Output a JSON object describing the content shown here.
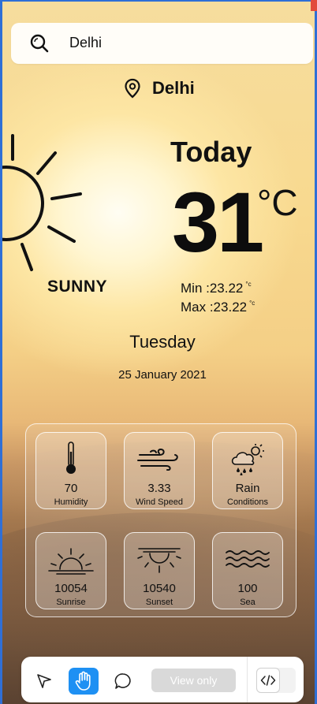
{
  "search": {
    "value": "Delhi",
    "icon": "search-icon"
  },
  "location": {
    "city": "Delhi",
    "icon": "location-pin-icon"
  },
  "weather": {
    "condition": "SUNNY",
    "heading": "Today",
    "temperature": "31",
    "unit": "°C",
    "min_label": "Min :23.22",
    "max_label": "Max :23.22",
    "min_unit": "°c",
    "max_unit": "°c",
    "day": "Tuesday",
    "date": "25 January 2021"
  },
  "stats": [
    {
      "value": "70",
      "label": "Humidity",
      "icon": "thermometer-icon"
    },
    {
      "value": "3.33",
      "label": "Wind Speed",
      "icon": "wind-icon"
    },
    {
      "value": "Rain",
      "label": "Conditions",
      "icon": "rain-cloud-icon"
    },
    {
      "value": "10054",
      "label": "Sunrise",
      "icon": "sunrise-icon"
    },
    {
      "value": "10540",
      "label": "Sunset",
      "icon": "sunset-icon"
    },
    {
      "value": "100",
      "label": "Sea",
      "icon": "waves-icon"
    }
  ],
  "toolbar": {
    "view_only_label": "View only",
    "tools": [
      "pointer-icon",
      "hand-icon",
      "comment-icon",
      "code-icon"
    ]
  },
  "colors": {
    "accent": "#1e90f3",
    "frame": "#2f6fd6"
  }
}
